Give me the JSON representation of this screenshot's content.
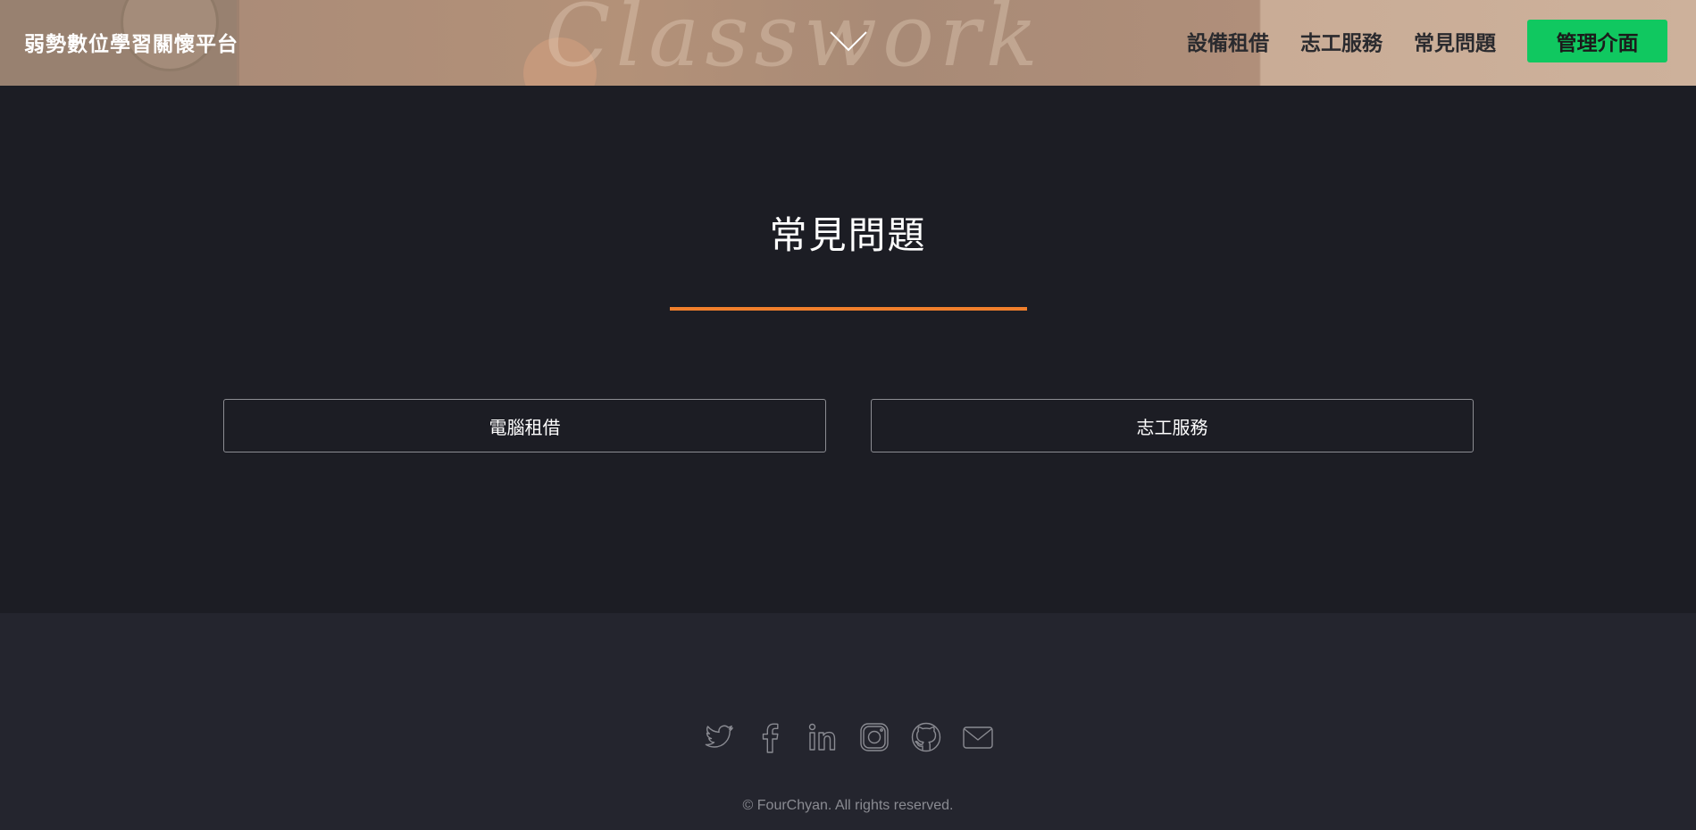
{
  "header": {
    "brand": "弱勢數位學習關懷平台",
    "background_text": "Classwork",
    "nav": [
      {
        "label": "設備租借"
      },
      {
        "label": "志工服務"
      },
      {
        "label": "常見問題"
      }
    ],
    "admin_label": "管理介面"
  },
  "faq": {
    "title": "常見問題",
    "buttons": [
      {
        "label": "電腦租借"
      },
      {
        "label": "志工服務"
      }
    ]
  },
  "footer": {
    "social_icons": [
      "twitter-icon",
      "facebook-icon",
      "linkedin-icon",
      "instagram-icon",
      "github-icon",
      "email-icon"
    ],
    "copyright": "© FourChyan. All rights reserved."
  },
  "colors": {
    "accent": "#f07f2c",
    "admin_button": "#10c860",
    "main_bg": "#1c1d24",
    "footer_bg": "#24252e"
  }
}
